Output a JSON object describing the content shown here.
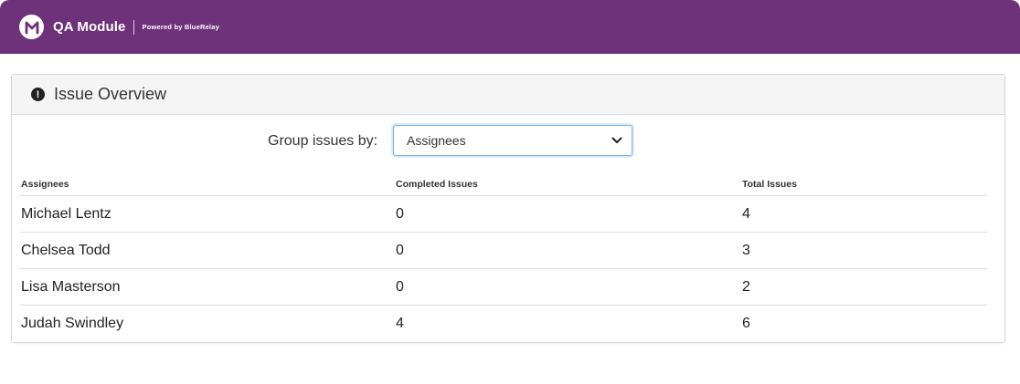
{
  "app": {
    "title": "QA Module",
    "powered_by": "Powered by BlueRelay",
    "brand_color": "#6e327a",
    "logo_icon": "m-logo-icon"
  },
  "panel": {
    "title": "Issue Overview",
    "icon": "exclamation-circle-icon",
    "group_label": "Group issues by:",
    "group_selected": "Assignees"
  },
  "table": {
    "headers": [
      "Assignees",
      "Completed Issues",
      "Total Issues"
    ],
    "rows": [
      {
        "name": "Michael Lentz",
        "completed": "0",
        "total": "4"
      },
      {
        "name": "Chelsea Todd",
        "completed": "0",
        "total": "3"
      },
      {
        "name": "Lisa Masterson",
        "completed": "0",
        "total": "2"
      },
      {
        "name": "Judah Swindley",
        "completed": "4",
        "total": "6"
      }
    ]
  }
}
